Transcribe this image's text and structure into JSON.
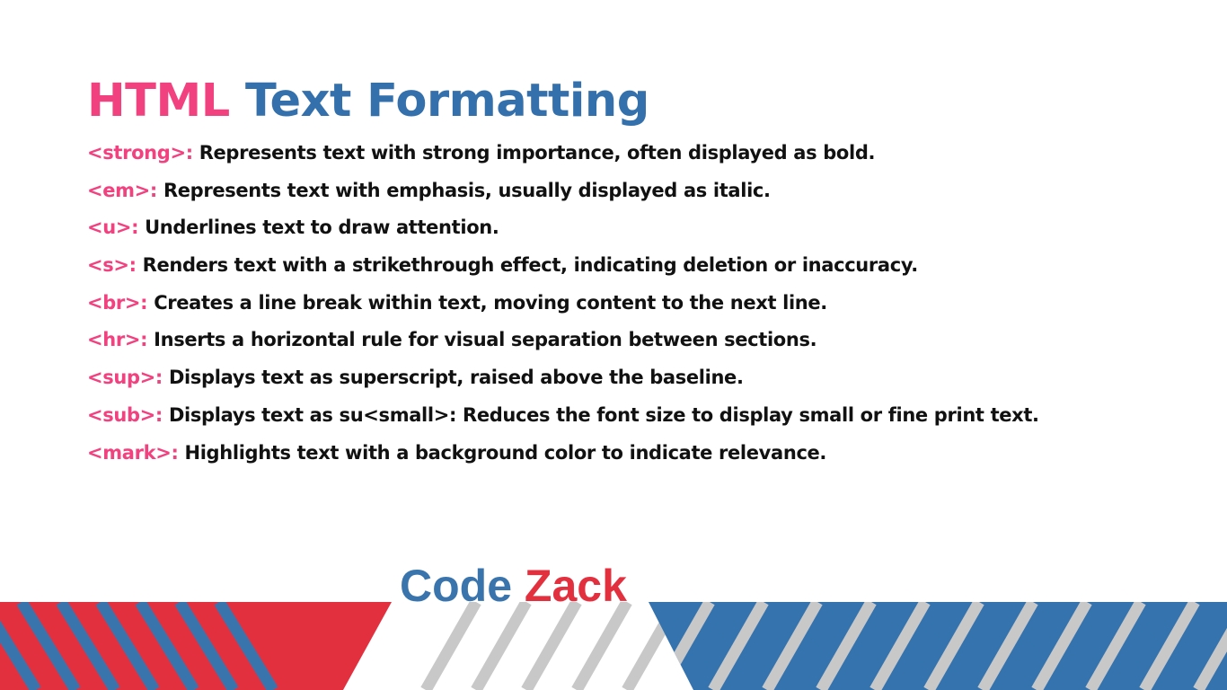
{
  "title": {
    "part1": "HTML",
    "part2": "Text Formatting"
  },
  "items": [
    {
      "tag": "<strong>:",
      "text": "Represents text with strong importance, often displayed as bold."
    },
    {
      "tag": "<em>:",
      "text": "Represents text with emphasis, usually displayed as italic."
    },
    {
      "tag": "<u>:",
      "text": "Underlines text to draw attention."
    },
    {
      "tag": "<s>:",
      "text": "Renders text with a strikethrough effect, indicating deletion or inaccuracy."
    },
    {
      "tag": "<br>:",
      "text": "Creates a line break within text, moving content to the next line."
    },
    {
      "tag": "<hr>:",
      "text": "Inserts a horizontal rule for visual separation between sections."
    },
    {
      "tag": "<sup>:",
      "text": "Displays text as superscript, raised above the baseline."
    },
    {
      "tag": "<sub>:",
      "text": "Displays text as su<small>: Reduces the font size to display small or fine print text."
    },
    {
      "tag": "<mark>:",
      "text": "Highlights text with a background color to indicate relevance."
    }
  ],
  "brand": {
    "part1": "Code",
    "part2": "Zack"
  },
  "colors": {
    "pink": "#f2417f",
    "blue": "#3470ac",
    "red": "#e3303f",
    "gray_stripe": "#c8c8c8"
  }
}
